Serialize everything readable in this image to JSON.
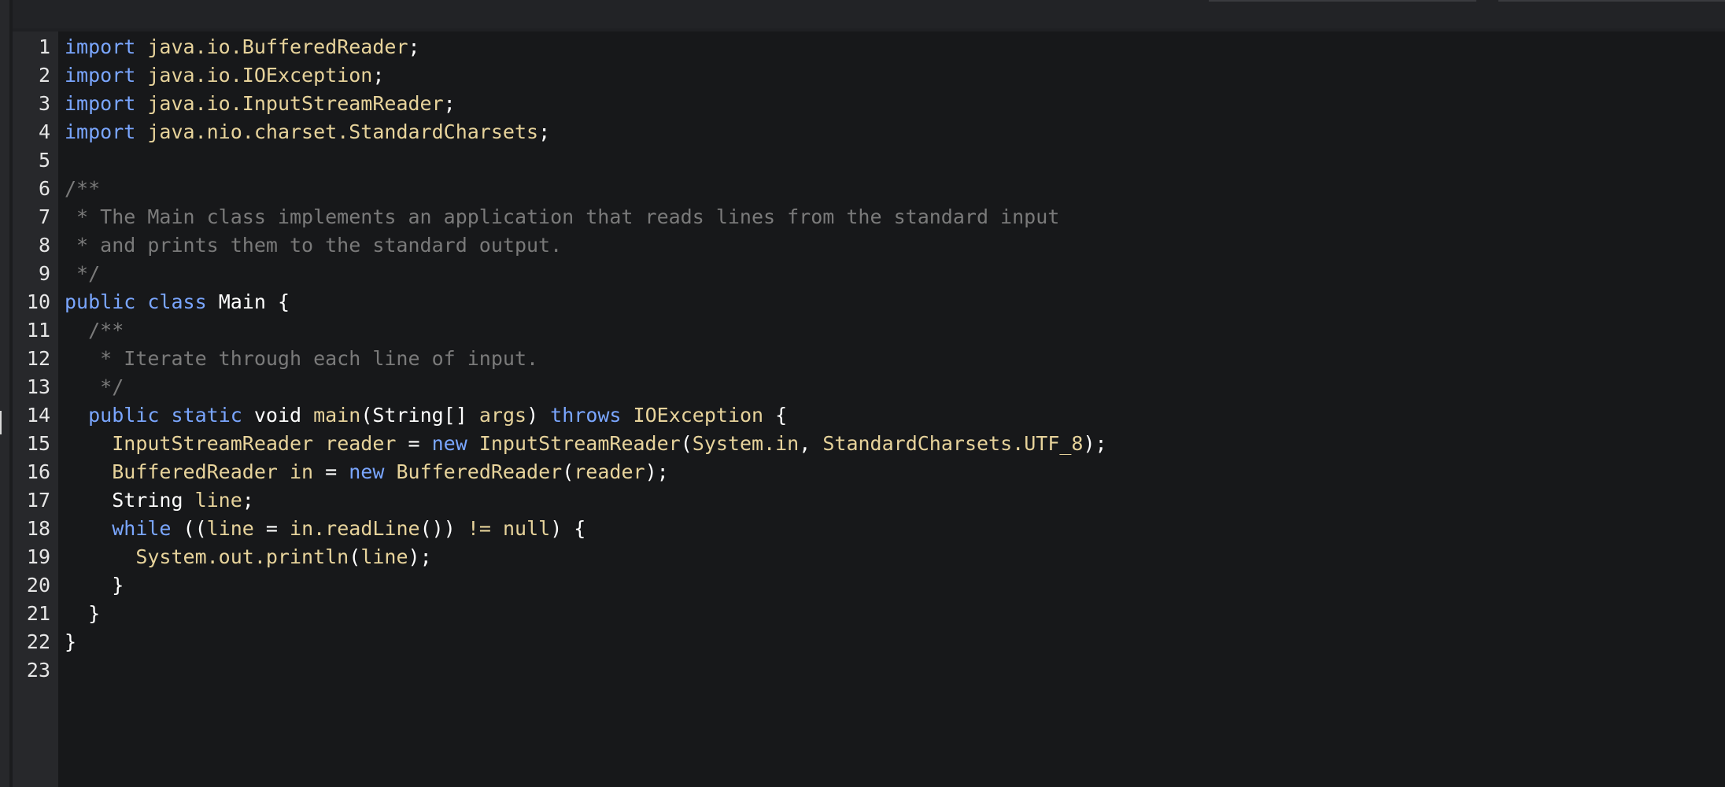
{
  "theme": {
    "editor_bg": "#17181a",
    "gutter_bg": "#27282b",
    "keyword": "#7aa6ff",
    "type": "#e7d39b",
    "comment": "#7a7a7a",
    "plain": "#ffffff",
    "line_number": "#e6e6e6"
  },
  "editor": {
    "language": "Java",
    "line_numbers": [
      "1",
      "2",
      "3",
      "4",
      "5",
      "6",
      "7",
      "8",
      "9",
      "10",
      "11",
      "12",
      "13",
      "14",
      "15",
      "16",
      "17",
      "18",
      "19",
      "20",
      "21",
      "22",
      "23"
    ],
    "lines": [
      [
        {
          "t": "import",
          "c": "kw"
        },
        {
          "t": " ",
          "c": "p"
        },
        {
          "t": "java.io.BufferedReader",
          "c": "ty"
        },
        {
          "t": ";",
          "c": "p"
        }
      ],
      [
        {
          "t": "import",
          "c": "kw"
        },
        {
          "t": " ",
          "c": "p"
        },
        {
          "t": "java.io.IOException",
          "c": "ty"
        },
        {
          "t": ";",
          "c": "p"
        }
      ],
      [
        {
          "t": "import",
          "c": "kw"
        },
        {
          "t": " ",
          "c": "p"
        },
        {
          "t": "java.io.InputStreamReader",
          "c": "ty"
        },
        {
          "t": ";",
          "c": "p"
        }
      ],
      [
        {
          "t": "import",
          "c": "kw"
        },
        {
          "t": " ",
          "c": "p"
        },
        {
          "t": "java.nio.charset.StandardCharsets",
          "c": "ty"
        },
        {
          "t": ";",
          "c": "p"
        }
      ],
      [],
      [
        {
          "t": "/**",
          "c": "cm"
        }
      ],
      [
        {
          "t": " * The Main class implements an application that reads lines from the standard input",
          "c": "cm"
        }
      ],
      [
        {
          "t": " * and prints them to the standard output.",
          "c": "cm"
        }
      ],
      [
        {
          "t": " */",
          "c": "cm"
        }
      ],
      [
        {
          "t": "public",
          "c": "kw"
        },
        {
          "t": " ",
          "c": "p"
        },
        {
          "t": "class",
          "c": "kw"
        },
        {
          "t": " Main {",
          "c": "p"
        }
      ],
      [
        {
          "t": "  /**",
          "c": "cm"
        }
      ],
      [
        {
          "t": "   * Iterate through each line of input.",
          "c": "cm"
        }
      ],
      [
        {
          "t": "   */",
          "c": "cm"
        }
      ],
      [
        {
          "t": "  ",
          "c": "p"
        },
        {
          "t": "public",
          "c": "kw"
        },
        {
          "t": " ",
          "c": "p"
        },
        {
          "t": "static",
          "c": "kw"
        },
        {
          "t": " void ",
          "c": "p"
        },
        {
          "t": "main",
          "c": "ty"
        },
        {
          "t": "(String[] ",
          "c": "p"
        },
        {
          "t": "args",
          "c": "ty"
        },
        {
          "t": ") ",
          "c": "p"
        },
        {
          "t": "throws",
          "c": "kw"
        },
        {
          "t": " ",
          "c": "p"
        },
        {
          "t": "IOException",
          "c": "ty"
        },
        {
          "t": " {",
          "c": "p"
        }
      ],
      [
        {
          "t": "    ",
          "c": "p"
        },
        {
          "t": "InputStreamReader reader",
          "c": "ty"
        },
        {
          "t": " = ",
          "c": "p"
        },
        {
          "t": "new",
          "c": "kw"
        },
        {
          "t": " ",
          "c": "p"
        },
        {
          "t": "InputStreamReader",
          "c": "ty"
        },
        {
          "t": "(",
          "c": "p"
        },
        {
          "t": "System.in",
          "c": "ty"
        },
        {
          "t": ", ",
          "c": "p"
        },
        {
          "t": "StandardCharsets.UTF_8",
          "c": "ty"
        },
        {
          "t": ");",
          "c": "p"
        }
      ],
      [
        {
          "t": "    ",
          "c": "p"
        },
        {
          "t": "BufferedReader in",
          "c": "ty"
        },
        {
          "t": " = ",
          "c": "p"
        },
        {
          "t": "new",
          "c": "kw"
        },
        {
          "t": " ",
          "c": "p"
        },
        {
          "t": "BufferedReader",
          "c": "ty"
        },
        {
          "t": "(",
          "c": "p"
        },
        {
          "t": "reader",
          "c": "ty"
        },
        {
          "t": ");",
          "c": "p"
        }
      ],
      [
        {
          "t": "    String ",
          "c": "p"
        },
        {
          "t": "line",
          "c": "ty"
        },
        {
          "t": ";",
          "c": "p"
        }
      ],
      [
        {
          "t": "    ",
          "c": "p"
        },
        {
          "t": "while",
          "c": "kw"
        },
        {
          "t": " ((",
          "c": "p"
        },
        {
          "t": "line",
          "c": "ty"
        },
        {
          "t": " = ",
          "c": "p"
        },
        {
          "t": "in.readLine",
          "c": "ty"
        },
        {
          "t": "()) ",
          "c": "p"
        },
        {
          "t": "!=",
          "c": "ty"
        },
        {
          "t": " ",
          "c": "p"
        },
        {
          "t": "null",
          "c": "ty"
        },
        {
          "t": ") {",
          "c": "p"
        }
      ],
      [
        {
          "t": "      ",
          "c": "p"
        },
        {
          "t": "System.out.println",
          "c": "ty"
        },
        {
          "t": "(",
          "c": "p"
        },
        {
          "t": "line",
          "c": "ty"
        },
        {
          "t": ");",
          "c": "p"
        }
      ],
      [
        {
          "t": "    }",
          "c": "p"
        }
      ],
      [
        {
          "t": "  }",
          "c": "p"
        }
      ],
      [
        {
          "t": "}",
          "c": "p"
        }
      ],
      []
    ]
  }
}
